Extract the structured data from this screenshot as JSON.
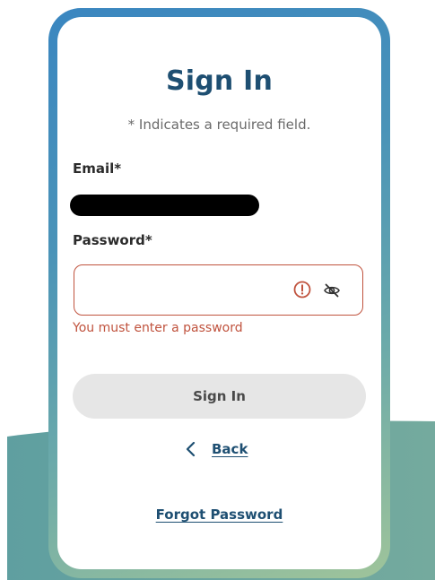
{
  "title": "Sign In",
  "required_note": "* Indicates a required field.",
  "email": {
    "label": "Email*",
    "value_redacted": true
  },
  "password": {
    "label": "Password*",
    "value": "",
    "error_message": "You must enter a password",
    "error_icon": "alert-circle-icon",
    "visibility_icon": "eye-off-icon"
  },
  "sign_in_button": "Sign In",
  "back_link": "Back",
  "forgot_password_link": "Forgot Password",
  "colors": {
    "title": "#1e4f72",
    "error": "#c0533e",
    "button_bg": "#e6e6e6",
    "frame_gradient_start": "#3a86c0",
    "frame_gradient_end": "#9fc49a",
    "wave": "#6fa9a3"
  }
}
